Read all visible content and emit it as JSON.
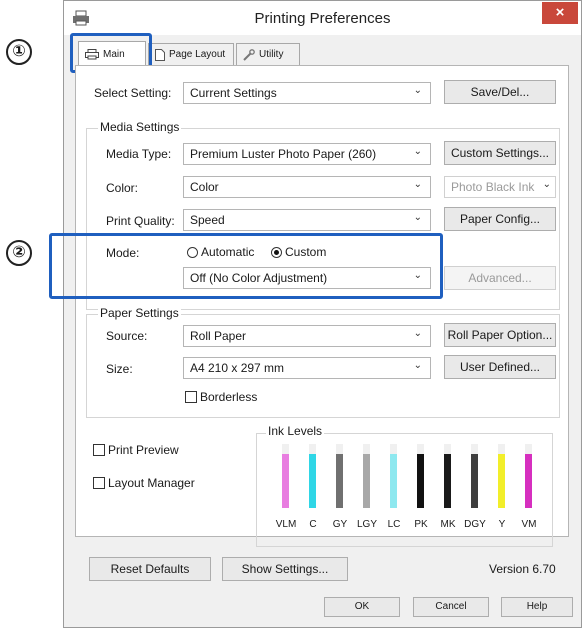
{
  "window": {
    "title": "Printing Preferences",
    "close_glyph": "×",
    "icon": "printer-icon"
  },
  "callouts": {
    "one": "①",
    "two": "②",
    "color": "#1f5fbf"
  },
  "tabs": [
    {
      "label": "Main",
      "icon": "printer-icon",
      "active": true
    },
    {
      "label": "Page Layout",
      "icon": "page-icon",
      "active": false
    },
    {
      "label": "Utility",
      "icon": "wrench-icon",
      "active": false
    }
  ],
  "select_setting": {
    "label": "Select Setting:",
    "value": "Current Settings",
    "button": "Save/Del..."
  },
  "media_settings": {
    "title": "Media Settings",
    "media_type": {
      "label": "Media Type:",
      "value": "Premium Luster Photo Paper (260)",
      "button": "Custom Settings..."
    },
    "color": {
      "label": "Color:",
      "value": "Color",
      "ink_value": "Photo Black Ink"
    },
    "print_quality": {
      "label": "Print Quality:",
      "value": "Speed",
      "button": "Paper Config..."
    },
    "mode": {
      "label": "Mode:",
      "automatic": "Automatic",
      "custom": "Custom",
      "selected": "Custom",
      "value": "Off (No Color Adjustment)",
      "advanced": "Advanced..."
    }
  },
  "paper_settings": {
    "title": "Paper Settings",
    "source": {
      "label": "Source:",
      "value": "Roll Paper",
      "button": "Roll Paper Option..."
    },
    "size": {
      "label": "Size:",
      "value": "A4 210 x 297 mm",
      "button": "User Defined..."
    },
    "borderless": {
      "label": "Borderless",
      "checked": false
    }
  },
  "options": {
    "print_preview": {
      "label": "Print Preview",
      "checked": false
    },
    "layout_manager": {
      "label": "Layout Manager",
      "checked": false
    }
  },
  "ink_levels": {
    "title": "Ink Levels",
    "inks": [
      {
        "label": "VLM",
        "color": "#e87de0",
        "level": 0.85
      },
      {
        "label": "C",
        "color": "#2fd6e6",
        "level": 0.85
      },
      {
        "label": "GY",
        "color": "#707070",
        "level": 0.85
      },
      {
        "label": "LGY",
        "color": "#a8a8a8",
        "level": 0.85
      },
      {
        "label": "LC",
        "color": "#8ee8ef",
        "level": 0.85
      },
      {
        "label": "PK",
        "color": "#111111",
        "level": 0.85
      },
      {
        "label": "MK",
        "color": "#1a1a1a",
        "level": 0.85
      },
      {
        "label": "DGY",
        "color": "#3e3e3e",
        "level": 0.85
      },
      {
        "label": "Y",
        "color": "#f2ee2a",
        "level": 0.85
      },
      {
        "label": "VM",
        "color": "#d62fbf",
        "level": 0.85
      }
    ]
  },
  "footer": {
    "reset": "Reset Defaults",
    "show_settings": "Show Settings...",
    "version": "Version 6.70",
    "ok": "OK",
    "cancel": "Cancel",
    "help": "Help"
  },
  "arrow_glyph": "⌄"
}
